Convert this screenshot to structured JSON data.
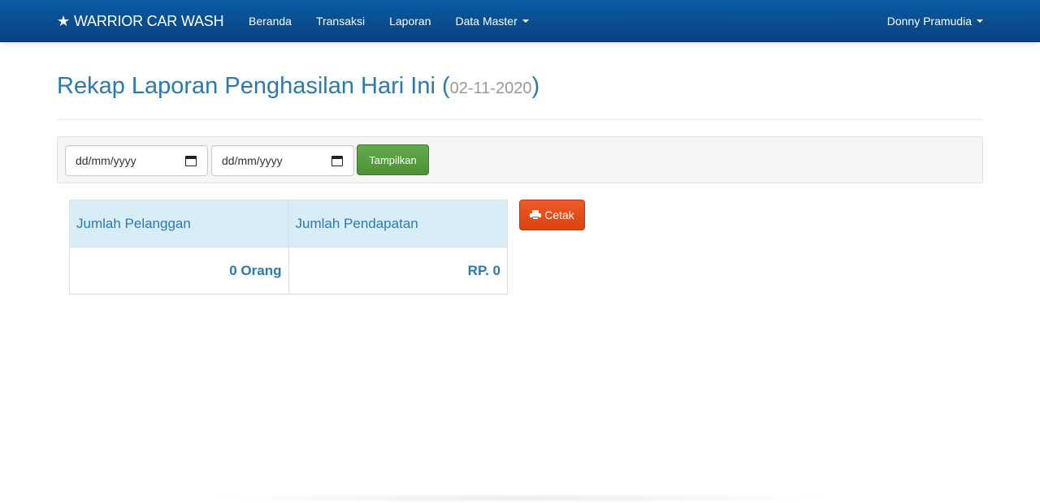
{
  "navbar": {
    "brand": "WARRIOR CAR WASH",
    "brand_icon": "star-icon",
    "links": [
      "Beranda",
      "Transaksi",
      "Laporan",
      "Data Master"
    ],
    "user": "Donny Pramudia",
    "bg_color": "#08427f"
  },
  "page": {
    "title": "Rekap Laporan Penghasilan Hari Ini",
    "date": "02-11-2020"
  },
  "filter": {
    "start_date_placeholder": "dd/mm/yyyy",
    "end_date_placeholder": "dd/mm/yyyy",
    "submit_label": "Tampilkan"
  },
  "summary": {
    "headers": [
      "Jumlah Pelanggan",
      "Jumlah Pendapatan"
    ],
    "values": [
      "0 Orang",
      "RP. 0"
    ]
  },
  "actions": {
    "print_label": "Cetak",
    "print_icon": "print-icon"
  }
}
